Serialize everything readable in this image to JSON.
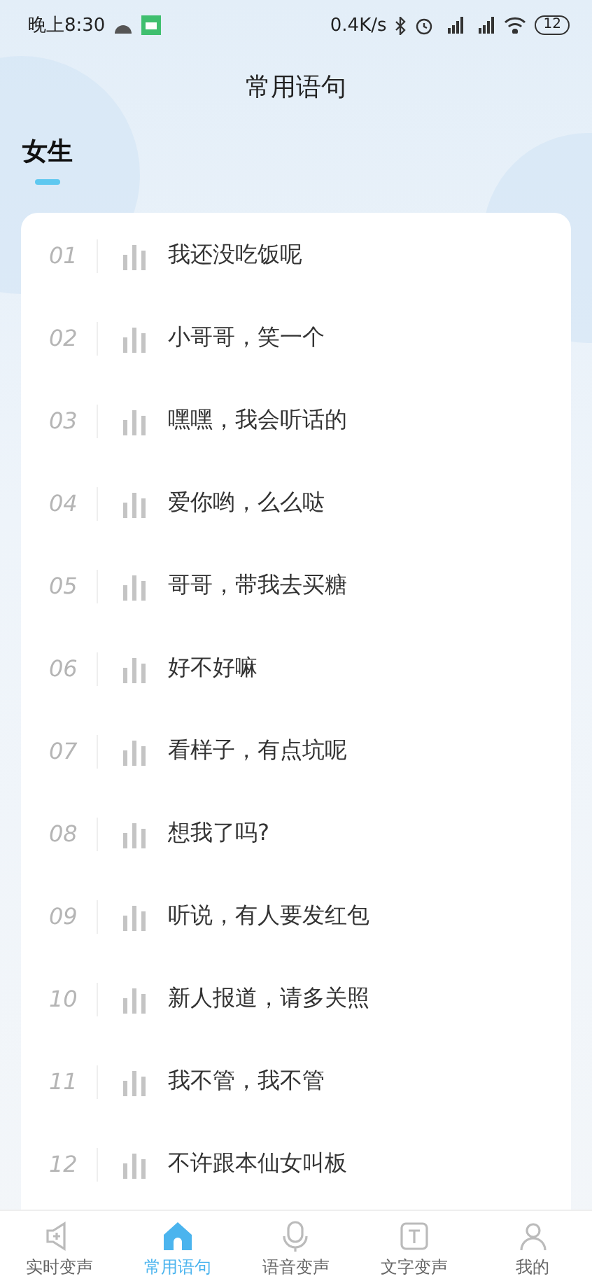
{
  "status_bar": {
    "time": "晚上8:30",
    "speed": "0.4K/s",
    "battery": "12"
  },
  "header": {
    "title": "常用语句"
  },
  "tabs": [
    {
      "label": "女生",
      "selected": true
    }
  ],
  "phrases": [
    {
      "number": "01",
      "text": "我还没吃饭呢"
    },
    {
      "number": "02",
      "text": "小哥哥，笑一个"
    },
    {
      "number": "03",
      "text": "嘿嘿，我会听话的"
    },
    {
      "number": "04",
      "text": "爱你哟，么么哒"
    },
    {
      "number": "05",
      "text": "哥哥，带我去买糖"
    },
    {
      "number": "06",
      "text": "好不好嘛"
    },
    {
      "number": "07",
      "text": "看样子，有点坑呢"
    },
    {
      "number": "08",
      "text": "想我了吗?"
    },
    {
      "number": "09",
      "text": "听说，有人要发红包"
    },
    {
      "number": "10",
      "text": "新人报道，请多关照"
    },
    {
      "number": "11",
      "text": "我不管，我不管"
    },
    {
      "number": "12",
      "text": "不许跟本仙女叫板"
    }
  ],
  "bottom_nav": [
    {
      "kind": "speaker",
      "label": "实时变声",
      "selected": false
    },
    {
      "kind": "home",
      "label": "常用语句",
      "selected": true
    },
    {
      "kind": "mic",
      "label": "语音变声",
      "selected": false
    },
    {
      "kind": "text",
      "label": "文字变声",
      "selected": false
    },
    {
      "kind": "person",
      "label": "我的",
      "selected": false
    }
  ]
}
